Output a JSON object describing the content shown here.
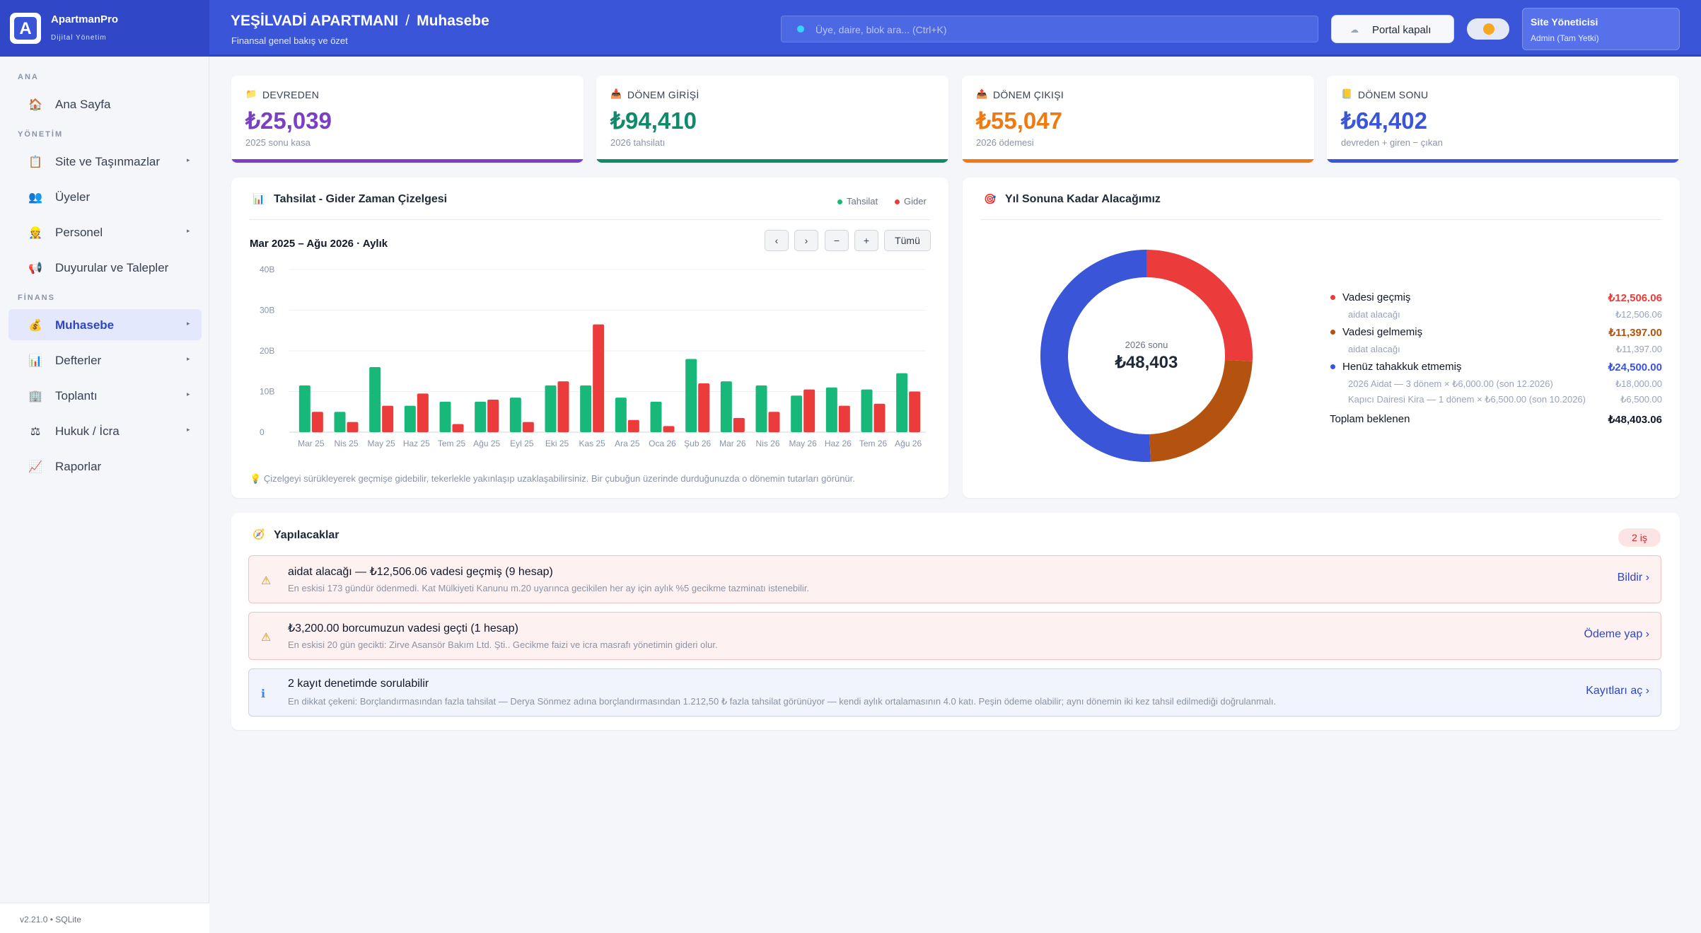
{
  "brand": {
    "logo_letter": "A",
    "name": "ApartmanPro",
    "sub": "Dijital Yönetim"
  },
  "header": {
    "building": "YEŞİLVADİ APARTMANI",
    "separator": "/",
    "section": "Muhasebe",
    "subtitle": "Finansal genel bakış ve özet",
    "search_placeholder": "Üye, daire, blok ara...  (Ctrl+K)",
    "portal_label": "Portal kapalı",
    "user_name": "Site Yöneticisi",
    "user_role": "Admin (Tam Yetki)"
  },
  "sidebar": {
    "sections": {
      "ana": "ANA",
      "yonetim": "YÖNETİM",
      "finans": "FİNANS"
    },
    "items": [
      {
        "label": "Ana Sayfa",
        "icon": "house-icon",
        "glyph": "🏠"
      },
      {
        "label": "Site ve Taşınmazlar",
        "icon": "clipboard-icon",
        "glyph": "📋",
        "arrow": "▸"
      },
      {
        "label": "Üyeler",
        "icon": "people-icon",
        "glyph": "👥"
      },
      {
        "label": "Personel",
        "icon": "person-icon",
        "glyph": "👷",
        "arrow": "▸"
      },
      {
        "label": "Duyurular ve Talepler",
        "icon": "megaphone-icon",
        "glyph": "📢"
      },
      {
        "label": "Muhasebe",
        "icon": "money-bag-icon",
        "glyph": "💰",
        "arrow": "▸",
        "active": true
      },
      {
        "label": "Defterler",
        "icon": "bar-chart-icon",
        "glyph": "📊",
        "arrow": "▸"
      },
      {
        "label": "Toplantı",
        "icon": "office-icon",
        "glyph": "🏢",
        "arrow": "▸"
      },
      {
        "label": "Hukuk / İcra",
        "icon": "scales-icon",
        "glyph": "⚖",
        "arrow": "▸"
      },
      {
        "label": "Raporlar",
        "icon": "trend-chart-icon",
        "glyph": "📈"
      }
    ],
    "version": "v2.21.0  •  SQLite"
  },
  "kpis": [
    {
      "title": "DEVREDEN",
      "value": "₺25,039",
      "sub": "2025 sonu kasa",
      "color": "#7b3fc4",
      "icon": "folder-icon",
      "glyph": "📁"
    },
    {
      "title": "DÖNEM GİRİŞİ",
      "value": "₺94,410",
      "sub": "2026 tahsilatı",
      "color": "#0f8a6b",
      "icon": "inbox-icon",
      "glyph": "📥"
    },
    {
      "title": "DÖNEM ÇIKIŞI",
      "value": "₺55,047",
      "sub": "2026 ödemesi",
      "color": "#f07a12",
      "icon": "outbox-icon",
      "glyph": "📤"
    },
    {
      "title": "DÖNEM SONU",
      "value": "₺64,402",
      "sub": "devreden + giren − çıkan",
      "color": "#3b55d8",
      "icon": "ledger-icon",
      "glyph": "📒"
    }
  ],
  "timeline": {
    "title": "Tahsilat - Gider Zaman Çizelgesi",
    "legend_in": "Tahsilat",
    "legend_out": "Gider",
    "range": "Mar 2025  –  Ağu 2026   ·   Aylık",
    "controls": [
      "‹",
      "›",
      "−",
      "+",
      "Tümü"
    ],
    "note": "Çizelgeyi sürükleyerek geçmişe gidebilir, tekerlekle yakınlaşıp uzaklaşabilirsiniz. Bir çubuğun üzerinde durduğunuzda o dönemin tutarları görünür."
  },
  "chart_data": {
    "type": "bar",
    "categories": [
      "Mar 25",
      "Nis 25",
      "May 25",
      "Haz 25",
      "Tem 25",
      "Ağu 25",
      "Eyl 25",
      "Eki 25",
      "Kas 25",
      "Ara 25",
      "Oca 26",
      "Şub 26",
      "Mar 26",
      "Nis 26",
      "May 26",
      "Haz 26",
      "Tem 26",
      "Ağu 26"
    ],
    "series": [
      {
        "name": "Tahsilat",
        "color": "#18b87a",
        "values": [
          11.5,
          5,
          16,
          6.5,
          7.5,
          7.5,
          8.5,
          11.5,
          11.5,
          8.5,
          7.5,
          18,
          12.5,
          11.5,
          9,
          11,
          10.5,
          14.5
        ]
      },
      {
        "name": "Gider",
        "color": "#ec3b3b",
        "values": [
          5,
          2.5,
          6.5,
          9.5,
          2,
          8,
          2.5,
          12.5,
          26.5,
          3,
          1.5,
          12,
          3.5,
          5,
          10.5,
          6.5,
          7,
          10
        ]
      }
    ],
    "y_ticks": [
      "0",
      "10B",
      "20B",
      "30B",
      "40B"
    ],
    "ylim": [
      0,
      40
    ],
    "grid": true,
    "legend": "top-right"
  },
  "receivables": {
    "title": "Yıl Sonuna Kadar Alacağımız",
    "center_sub": "2026 sonu",
    "center_value": "₺48,403",
    "slices": [
      {
        "label": "Vadesi geçmiş",
        "value": 12506.06,
        "color": "#ec3b3b",
        "display": "₺12,506.06",
        "sub_label": "aidat alacağı",
        "sub_value": "₺12,506.06"
      },
      {
        "label": "Vadesi gelmemiş",
        "value": 11397.0,
        "color": "#b4520f",
        "display": "₺11,397.00",
        "sub_label": "aidat alacağı",
        "sub_value": "₺11,397.00"
      },
      {
        "label": "Henüz tahakkuk etmemiş",
        "value": 24500.0,
        "color": "#3b55d8",
        "display": "₺24,500.00"
      }
    ],
    "not_accrued_details": [
      {
        "label": "2026 Aidat — 3 dönem × ₺6,000.00 (son 12.2026)",
        "value": "₺18,000.00"
      },
      {
        "label": "Kapıcı Dairesi Kira — 1 dönem × ₺6,500.00 (son 10.2026)",
        "value": "₺6,500.00"
      }
    ],
    "total_label": "Toplam beklenen",
    "total_value": "₺48,403.06"
  },
  "todos": {
    "title": "Yapılacaklar",
    "badge": "2 iş",
    "items": [
      {
        "type": "warn",
        "icon": "warning-icon",
        "glyph": "⚠",
        "title": "aidat alacağı — ₺12,506.06 vadesi geçmiş (9 hesap)",
        "desc": "En eskisi 173 gündür ödenmedi. Kat Mülkiyeti Kanunu m.20 uyarınca gecikilen her ay için aylık %5 gecikme tazminatı istenebilir.",
        "action": "Bildir  ›"
      },
      {
        "type": "warn",
        "icon": "warning-icon",
        "glyph": "⚠",
        "title": "₺3,200.00 borcumuzun vadesi geçti (1 hesap)",
        "desc": "En eskisi 20 gün gecikti: Zirve Asansör Bakım Ltd. Şti.. Gecikme faizi ve icra masrafı yönetimin gideri olur.",
        "action": "Ödeme yap  ›"
      },
      {
        "type": "info",
        "icon": "info-icon",
        "glyph": "ℹ",
        "title": "2 kayıt denetimde sorulabilir",
        "desc": "En dikkat çekeni: Borçlandırmasından fazla tahsilat — Derya Sönmez adına borçlandırmasından 1.212,50 ₺ fazla tahsilat görünüyor — kendi aylık ortalamasının 4.0 katı. Peşin ödeme olabilir; aynı dönemin iki kez tahsil edilmediği doğrulanmalı.",
        "action": "Kayıtları aç  ›"
      }
    ]
  }
}
